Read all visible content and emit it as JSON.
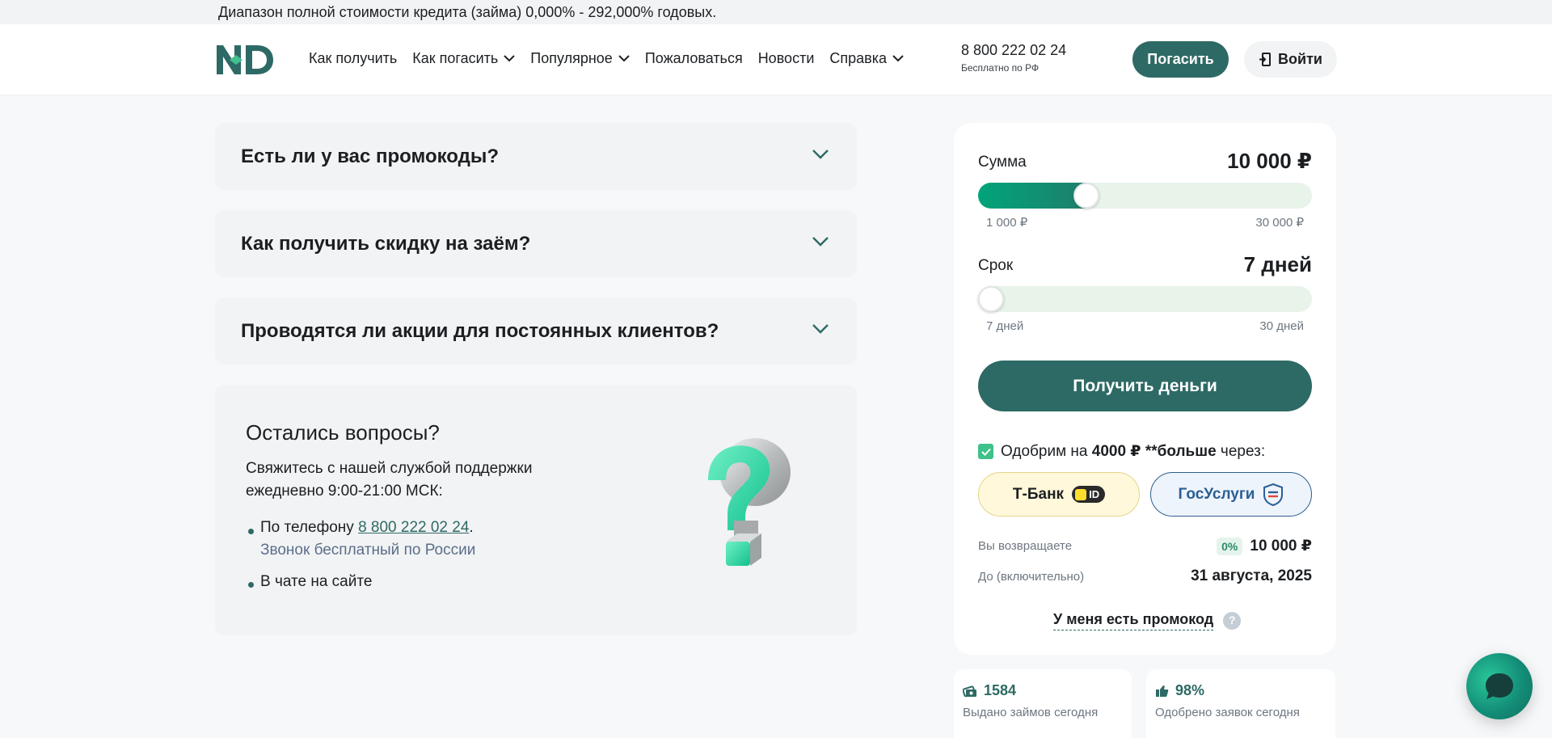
{
  "topbar": {
    "text": "Диапазон полной стоимости кредита (займа) 0,000% - 292,000% годовых."
  },
  "header": {
    "logo_text": "ND",
    "nav": [
      {
        "label": "Как получить",
        "dropdown": false
      },
      {
        "label": "Как погасить",
        "dropdown": true
      },
      {
        "label": "Популярное",
        "dropdown": true
      },
      {
        "label": "Пожаловаться",
        "dropdown": false
      },
      {
        "label": "Новости",
        "dropdown": false
      },
      {
        "label": "Справка",
        "dropdown": true
      }
    ],
    "phone": "8 800 222 02 24",
    "phone_sub": "Бесплатно по РФ",
    "pay_label": "Погасить",
    "login_label": "Войти"
  },
  "faq": [
    {
      "question": "Есть ли у вас промокоды?"
    },
    {
      "question": "Как получить скидку на заём?"
    },
    {
      "question": "Проводятся ли акции для постоянных клиентов?"
    }
  ],
  "support": {
    "title": "Остались вопросы?",
    "description": "Свяжитесь с нашей службой поддержки ежедневно 9:00-21:00 МСК:",
    "phone_prefix": "По телефону ",
    "phone_link": "8 800 222 02 24",
    "phone_suffix": ".",
    "phone_note": "Звонок бесплатный по России",
    "chat_item": "В чате на сайте"
  },
  "calculator": {
    "sum_label": "Сумма",
    "sum_value": "10 000 ₽",
    "sum_min": "1 000 ₽",
    "sum_max": "30 000 ₽",
    "sum_fraction": 0.31,
    "term_label": "Срок",
    "term_value": "7 дней",
    "term_min": "7 дней",
    "term_max": "30 дней",
    "term_fraction": 0.0,
    "get_money_label": "Получить деньги",
    "approve_pre": "Одобрим на ",
    "approve_amount": "4000 ₽",
    "approve_more": " **больше",
    "approve_post": " через:",
    "tbank_label": "Т-Банк",
    "tbank_badge": "ID",
    "gosuslugi_label": "ГосУслуги",
    "return_label": "Вы возвращаете",
    "return_percent": "0%",
    "return_value": "10 000 ₽",
    "until_label": "До (включительно)",
    "until_value": "31 августа, 2025",
    "promo_label": "У меня есть промокод",
    "promo_help": "?"
  },
  "stats": [
    {
      "value": "1584",
      "caption": "Выдано займов сегодня",
      "icon": "money-icon"
    },
    {
      "value": "98%",
      "caption": "Одобрено заявок сегодня",
      "icon": "thumbs-up-icon"
    }
  ],
  "colors": {
    "brand": "#2e6a65",
    "accent": "#00a47a",
    "slider_track": "#e8f3ea"
  }
}
